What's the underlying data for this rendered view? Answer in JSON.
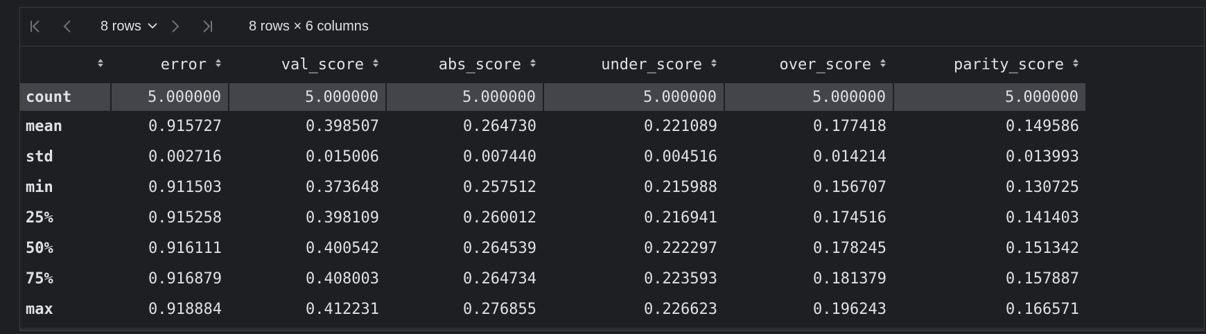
{
  "toolbar": {
    "rows_label": "8 rows",
    "dims_label": "8 rows × 6 columns",
    "icons": [
      "first-page-icon",
      "prev-page-icon",
      "chevron-down-icon",
      "next-page-icon",
      "last-page-icon"
    ]
  },
  "table": {
    "columns": [
      "error",
      "val_score",
      "abs_score",
      "under_score",
      "over_score",
      "parity_score"
    ],
    "rows": [
      {
        "index": "count",
        "values": [
          "5.000000",
          "5.000000",
          "5.000000",
          "5.000000",
          "5.000000",
          "5.000000"
        ]
      },
      {
        "index": "mean",
        "values": [
          "0.915727",
          "0.398507",
          "0.264730",
          "0.221089",
          "0.177418",
          "0.149586"
        ]
      },
      {
        "index": "std",
        "values": [
          "0.002716",
          "0.015006",
          "0.007440",
          "0.004516",
          "0.014214",
          "0.013993"
        ]
      },
      {
        "index": "min",
        "values": [
          "0.911503",
          "0.373648",
          "0.257512",
          "0.215988",
          "0.156707",
          "0.130725"
        ]
      },
      {
        "index": "25%",
        "values": [
          "0.915258",
          "0.398109",
          "0.260012",
          "0.216941",
          "0.174516",
          "0.141403"
        ]
      },
      {
        "index": "50%",
        "values": [
          "0.916111",
          "0.400542",
          "0.264539",
          "0.222297",
          "0.178245",
          "0.151342"
        ]
      },
      {
        "index": "75%",
        "values": [
          "0.916879",
          "0.408003",
          "0.264734",
          "0.223593",
          "0.181379",
          "0.157887"
        ]
      },
      {
        "index": "max",
        "values": [
          "0.918884",
          "0.412231",
          "0.276855",
          "0.226623",
          "0.196243",
          "0.166571"
        ]
      }
    ],
    "selected_row": "count"
  },
  "colors": {
    "background": "#1e1f22",
    "selected_row": "#43454a",
    "text": "#dfe1e5",
    "border": "#393b40"
  }
}
